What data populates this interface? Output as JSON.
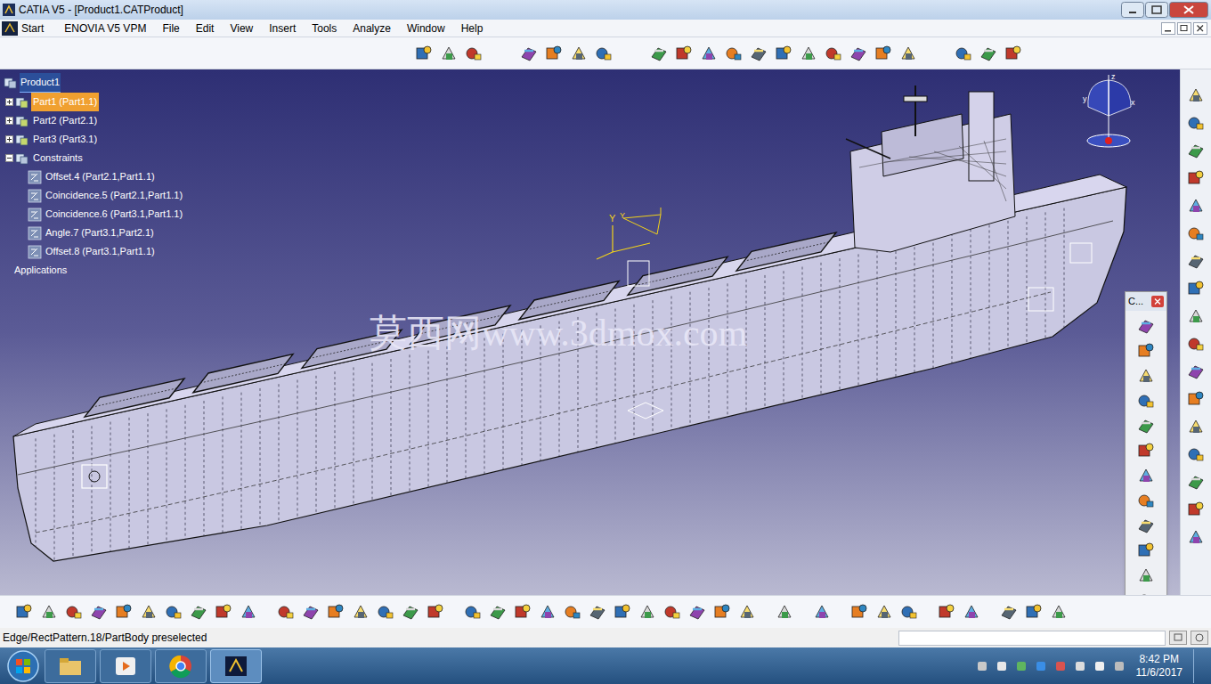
{
  "window": {
    "title": "CATIA V5 - [Product1.CATProduct]"
  },
  "menu": [
    {
      "label": "Start"
    },
    {
      "label": "ENOVIA V5 VPM"
    },
    {
      "label": "File"
    },
    {
      "label": "Edit"
    },
    {
      "label": "View"
    },
    {
      "label": "Insert"
    },
    {
      "label": "Tools"
    },
    {
      "label": "Analyze"
    },
    {
      "label": "Window"
    },
    {
      "label": "Help"
    }
  ],
  "tree": {
    "root": {
      "label": "Product1",
      "selected": true
    },
    "parts": [
      {
        "label": "Part1 (Part1.1)",
        "selected": true,
        "expanded": false
      },
      {
        "label": "Part2 (Part2.1)",
        "selected": false,
        "expanded": false
      },
      {
        "label": "Part3 (Part3.1)",
        "selected": false,
        "expanded": false
      }
    ],
    "constraints": {
      "label": "Constraints",
      "expanded": true,
      "items": [
        "Offset.4 (Part2.1,Part1.1)",
        "Coincidence.5 (Part2.1,Part1.1)",
        "Coincidence.6 (Part3.1,Part1.1)",
        "Angle.7 (Part3.1,Part2.1)",
        "Offset.8 (Part3.1,Part1.1)"
      ]
    },
    "applications": "Applications"
  },
  "viewport": {
    "watermark": "莫西网www.3dmox.com",
    "triad_labels": [
      "Y",
      "Y"
    ]
  },
  "compass": {
    "labels": [
      "z",
      "y",
      "x"
    ]
  },
  "floating_toolbar": {
    "title": "C..."
  },
  "status_bar": {
    "text": "Edge/RectPattern.18/PartBody preselected",
    "input": ""
  },
  "taskbar": {
    "time": "8:42 PM",
    "date": "11/6/2017"
  }
}
